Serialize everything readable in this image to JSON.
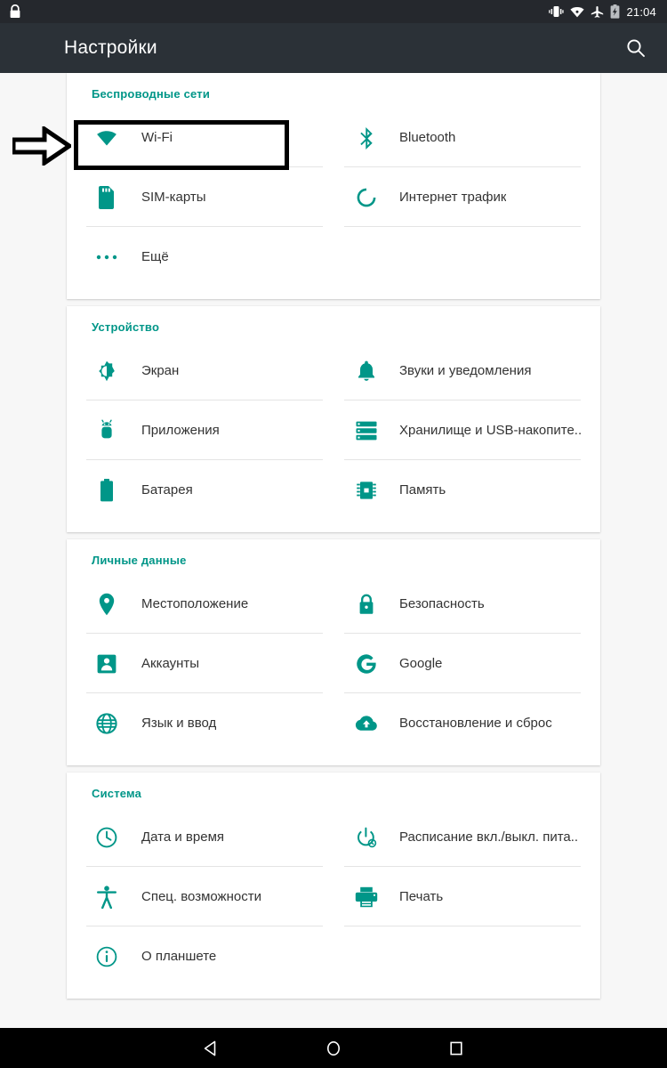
{
  "statusbar": {
    "lock_icon": "lock-icon",
    "icons": [
      "vibrate-icon",
      "wifi-icon",
      "airplane-mode-icon",
      "battery-charging-icon"
    ],
    "time": "21:04"
  },
  "appbar": {
    "title": "Настройки",
    "search_icon": "search-icon"
  },
  "annotation": {
    "arrow": "right-arrow-annotation",
    "highlight_target": "Wi-Fi"
  },
  "sections": [
    {
      "title": "Беспроводные сети",
      "items": [
        {
          "label": "Wi-Fi",
          "icon": "wifi-icon"
        },
        {
          "label": "Bluetooth",
          "icon": "bluetooth-icon"
        },
        {
          "label": "SIM-карты",
          "icon": "sim-card-icon"
        },
        {
          "label": "Интернет трафик",
          "icon": "data-usage-icon"
        },
        {
          "label": "Ещё",
          "icon": "more-horizontal-icon"
        }
      ]
    },
    {
      "title": "Устройство",
      "items": [
        {
          "label": "Экран",
          "icon": "brightness-icon"
        },
        {
          "label": "Звуки и уведомления",
          "icon": "bell-icon"
        },
        {
          "label": "Приложения",
          "icon": "android-robot-icon"
        },
        {
          "label": "Хранилище и USB-накопите..",
          "icon": "storage-icon"
        },
        {
          "label": "Батарея",
          "icon": "battery-icon"
        },
        {
          "label": "Память",
          "icon": "memory-chip-icon"
        }
      ]
    },
    {
      "title": "Личные данные",
      "items": [
        {
          "label": "Местоположение",
          "icon": "location-pin-icon"
        },
        {
          "label": "Безопасность",
          "icon": "lock-icon"
        },
        {
          "label": "Аккаунты",
          "icon": "account-icon"
        },
        {
          "label": "Google",
          "icon": "google-g-icon"
        },
        {
          "label": "Язык и ввод",
          "icon": "globe-icon"
        },
        {
          "label": "Восстановление и сброс",
          "icon": "backup-cloud-icon"
        }
      ]
    },
    {
      "title": "Система",
      "items": [
        {
          "label": "Дата и время",
          "icon": "clock-icon"
        },
        {
          "label": "Расписание вкл./выкл. пита..",
          "icon": "power-schedule-icon"
        },
        {
          "label": "Спец. возможности",
          "icon": "accessibility-icon"
        },
        {
          "label": "Печать",
          "icon": "printer-icon"
        },
        {
          "label": "О планшете",
          "icon": "info-icon"
        }
      ]
    }
  ],
  "navbar": {
    "back": "back-triangle-icon",
    "home": "home-circle-icon",
    "recents": "recents-square-icon"
  },
  "colors": {
    "accent": "#009688",
    "appbar": "#2b3137",
    "statusbar": "#25282d",
    "background": "#f7f7f7",
    "card": "#ffffff",
    "text": "#333333"
  }
}
